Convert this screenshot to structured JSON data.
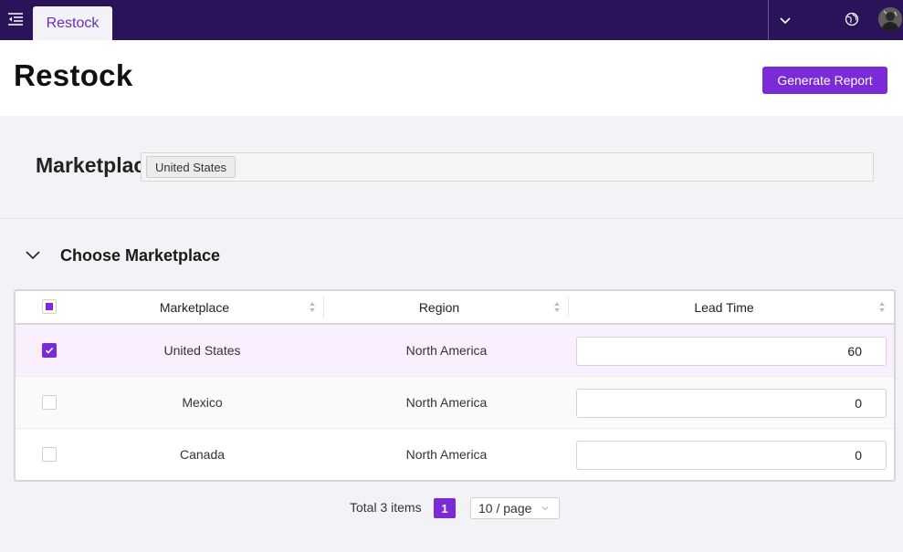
{
  "topbar": {
    "active_tab": "Restock",
    "icons": [
      "menu-icon",
      "chevron-down-icon",
      "globe-icon",
      "avatar"
    ],
    "background": "#2a1358"
  },
  "header": {
    "title": "Restock",
    "generate_report_label": "Generate Report"
  },
  "filter": {
    "label": "Marketplace",
    "selected_tags": [
      "United States"
    ]
  },
  "section": {
    "title": "Choose Marketplace"
  },
  "table": {
    "columns": [
      "Marketplace",
      "Region",
      "Lead Time"
    ],
    "rows": [
      {
        "marketplace": "United States",
        "region": "North America",
        "lead_time": "60",
        "selected": true
      },
      {
        "marketplace": "Mexico",
        "region": "North America",
        "lead_time": "0",
        "selected": false
      },
      {
        "marketplace": "Canada",
        "region": "North America",
        "lead_time": "0",
        "selected": false
      }
    ]
  },
  "pagination": {
    "total_label": "Total 3 items",
    "current_page": "1",
    "page_size_label": "10 / page"
  },
  "colors": {
    "accent": "#7a2bd6",
    "selected_row": "#f9efff"
  }
}
